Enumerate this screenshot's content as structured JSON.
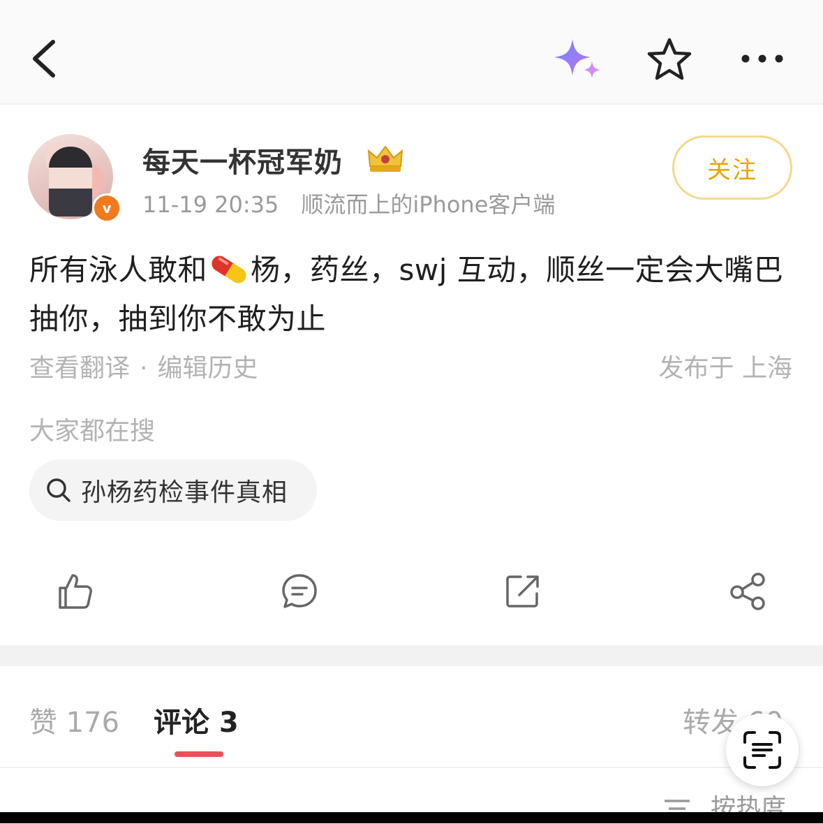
{
  "nav": {
    "back_icon": "chevron-left-icon",
    "ai_icon": "sparkle-icon",
    "favorite_icon": "star-outline-icon",
    "more_icon": "more-horizontal-icon"
  },
  "author": {
    "name": "每天一杯冠军奶",
    "badge_icon": "crown-icon",
    "verified_icon": "verified-v-icon",
    "time": "11-19 20:35",
    "source": "顺流而上的iPhone客户端",
    "follow_label": "关注"
  },
  "post": {
    "text_before_emoji": "所有泳人敢和",
    "emoji": "pill-icon",
    "text_after_emoji": "杨，药丝，swj 互动，顺丝一定会大嘴巴抽你，抽到你不敢为止",
    "translate_label": "查看翻译",
    "separator": "·",
    "edit_history_label": "编辑历史",
    "location_label": "发布于 上海"
  },
  "trending": {
    "title": "大家都在搜",
    "item": "孙杨药检事件真相"
  },
  "action_icons": [
    "thumbs-up-icon",
    "comment-icon",
    "repost-icon",
    "share-icon"
  ],
  "tabs": {
    "likes": "赞 176",
    "comments": "评论 3",
    "reposts": "转发 60"
  },
  "sort_label": "按热度",
  "colors": {
    "accent_red": "#e8505b",
    "follow_gold": "#e9a400",
    "verified_orange": "#f07a1c"
  }
}
